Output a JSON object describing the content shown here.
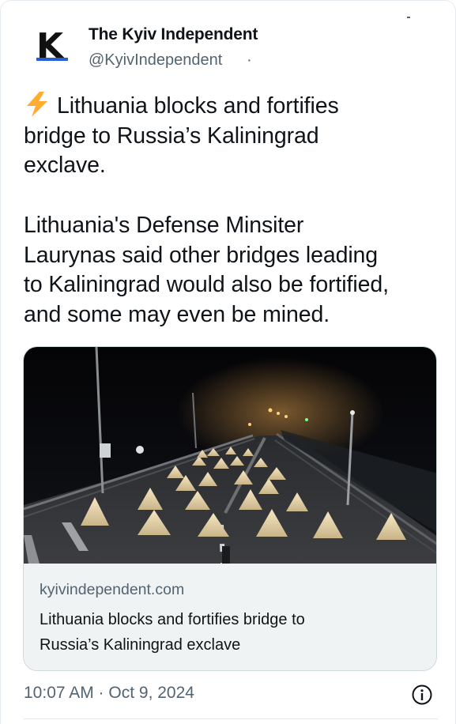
{
  "author": {
    "name": "The Kyiv Independent",
    "handle": "@KyivIndependent",
    "handle_separator": "·",
    "avatar_letter": "K"
  },
  "tweet": {
    "paragraph1": [
      {
        "icon": "lightning-bolt-icon",
        "text": "Lithuania blocks and fortifies"
      },
      {
        "text": "bridge to Russia’s Kaliningrad"
      },
      {
        "text": "exclave."
      }
    ],
    "paragraph2": [
      {
        "text": "Lithuania's Defense Minsiter"
      },
      {
        "text": "Laurynas said other bridges leading"
      },
      {
        "text": "to Kaliningrad would also be fortified,"
      },
      {
        "text": "and some may even be mined."
      }
    ]
  },
  "link_card": {
    "image_icon": "night-bridge-barricade-photo",
    "domain": "kyivindependent.com",
    "title_line1": "Lithuania blocks and fortifies bridge to",
    "title_line2": "Russia’s Kaliningrad exclave"
  },
  "footer": {
    "timestamp": "10:07 AM · Oct 9, 2024",
    "info_icon": "info-icon"
  },
  "colors": {
    "text_primary": "#0f1419",
    "text_secondary": "#536471",
    "card_border": "#cfd9de",
    "card_meta_bg": "#eff3f4",
    "bolt": "#ffac33",
    "logo_accent": "#2a5bd7"
  }
}
